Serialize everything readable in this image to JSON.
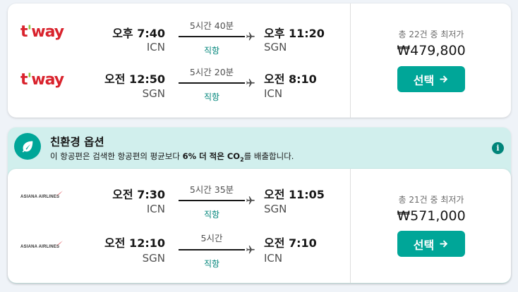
{
  "results": [
    {
      "legs": [
        {
          "airline": "t'way",
          "dep_time": "오후 7:40",
          "dep_code": "ICN",
          "duration": "5시간 40분",
          "stops": "직항",
          "arr_time": "오후 11:20",
          "arr_code": "SGN"
        },
        {
          "airline": "t'way",
          "dep_time": "오전 12:50",
          "dep_code": "SGN",
          "duration": "5시간 20분",
          "stops": "직항",
          "arr_time": "오전 8:10",
          "arr_code": "ICN"
        }
      ],
      "provider_count": "총 22건 중 최저가",
      "price": "₩479,800",
      "select_label": "선택"
    },
    {
      "legs": [
        {
          "airline": "ASIANA AIRLINES",
          "dep_time": "오전 7:30",
          "dep_code": "ICN",
          "duration": "5시간 35분",
          "stops": "직항",
          "arr_time": "오전 11:05",
          "arr_code": "SGN"
        },
        {
          "airline": "ASIANA AIRLINES",
          "dep_time": "오전 12:10",
          "dep_code": "SGN",
          "duration": "5시간",
          "stops": "직항",
          "arr_time": "오전 7:10",
          "arr_code": "ICN"
        }
      ],
      "provider_count": "총 21건 중 최저가",
      "price": "₩571,000",
      "select_label": "선택"
    }
  ],
  "eco_banner": {
    "title": "친환경 옵션",
    "desc_prefix": "이 항공편은 검색한 항공편의 평균보다 ",
    "desc_highlight": "6% 더 적은 CO",
    "desc_sub": "2",
    "desc_suffix": "를 배출합니다.",
    "info_icon": "i"
  },
  "colors": {
    "accent": "#00a698",
    "eco_bg": "#d1efed",
    "stops_green": "#00857a",
    "tway_red": "#d9232d"
  },
  "icons": [
    "plane-icon",
    "arrow-right-icon",
    "leaf-icon",
    "info-icon"
  ]
}
